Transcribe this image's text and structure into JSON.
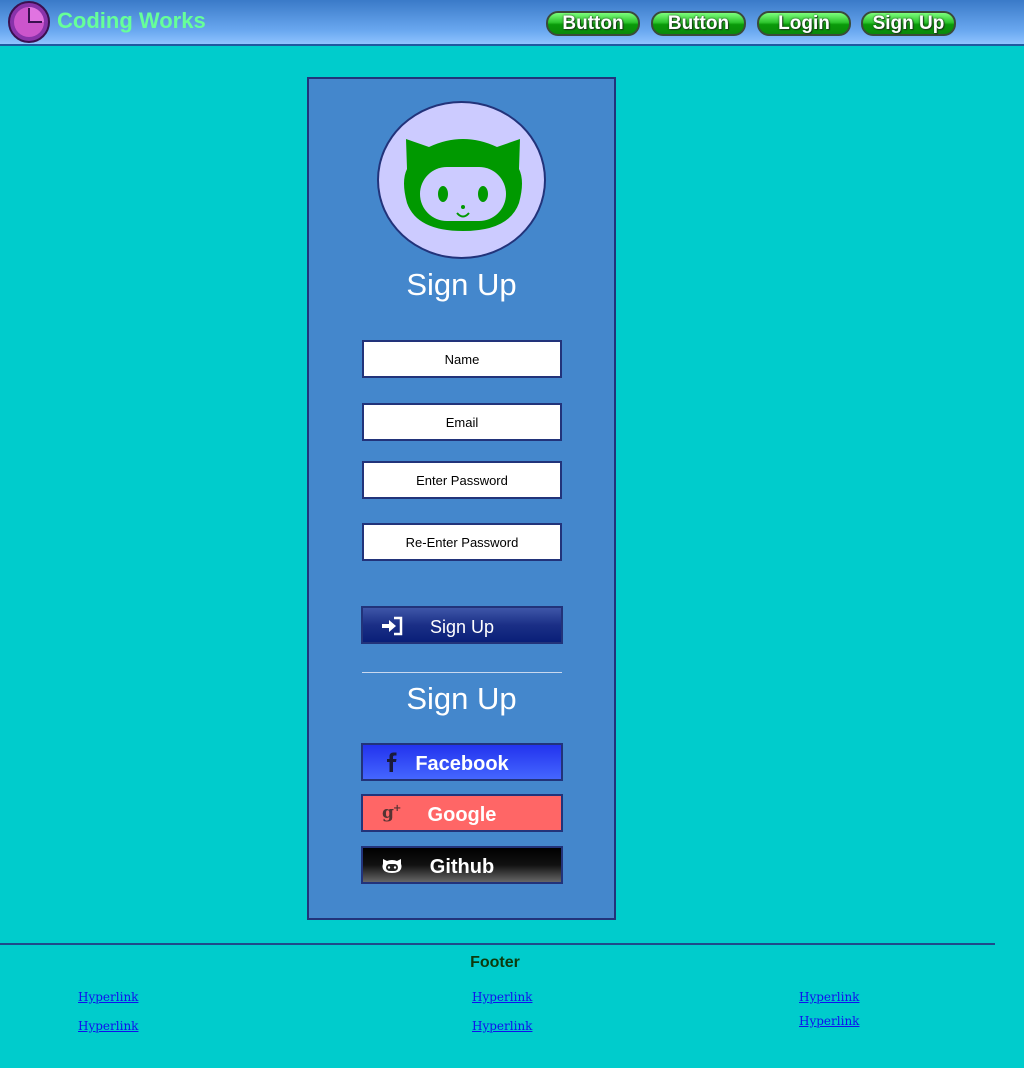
{
  "header": {
    "brand": "Coding Works",
    "nav": [
      "Button",
      "Button",
      "Login",
      "Sign Up"
    ]
  },
  "card": {
    "avatar_icon": "github-octocat-icon",
    "title": "Sign Up",
    "fields": {
      "name_placeholder": "Name",
      "email_placeholder": "Email",
      "password_placeholder": "Enter Password",
      "repassword_placeholder": "Re-Enter Password"
    },
    "signup_button": {
      "label": "Sign Up",
      "icon": "sign-in-icon"
    },
    "social_title": "Sign Up",
    "social": [
      {
        "label": "Facebook",
        "icon": "facebook-icon",
        "color": "#3344ff"
      },
      {
        "label": "Google",
        "icon": "google-plus-icon",
        "color": "#ff6666"
      },
      {
        "label": "Github",
        "icon": "github-icon",
        "color": "#111111"
      }
    ]
  },
  "footer": {
    "title": "Footer",
    "links": [
      "Hyperlink",
      "Hyperlink",
      "Hyperlink",
      "Hyperlink",
      "Hyperlink",
      "Hyperlink"
    ]
  },
  "colors": {
    "background": "#00cccc",
    "card": "#4487cc",
    "brand_text": "#66ff99",
    "avatar_bg": "#cccbff",
    "octocat": "#009900"
  }
}
